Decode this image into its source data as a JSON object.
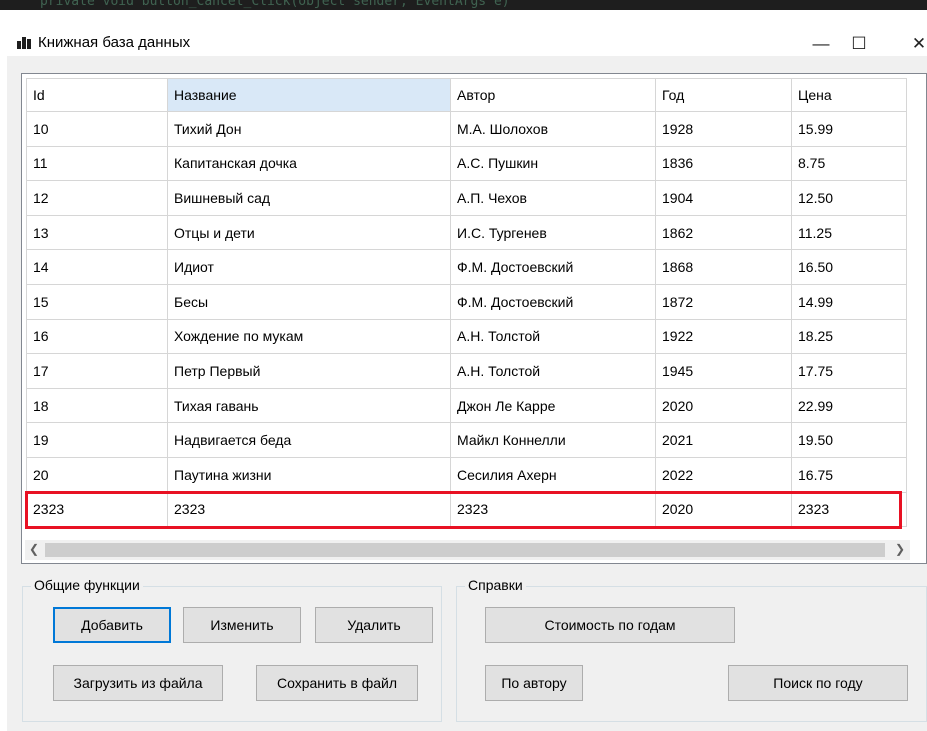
{
  "code_strip_text": "private void button_Cancel_Click(object sender, EventArgs e)",
  "window": {
    "title": "Книжная база данных",
    "minimize_glyph": "—",
    "maximize_glyph": "☐",
    "close_glyph": "✕"
  },
  "grid": {
    "columns": [
      "Id",
      "Название",
      "Автор",
      "Год",
      "Цена"
    ],
    "selected_column": "Название",
    "rows": [
      [
        "10",
        "Тихий Дон",
        "М.А. Шолохов",
        "1928",
        "15.99"
      ],
      [
        "11",
        "Капитанская дочка",
        "А.С. Пушкин",
        "1836",
        "8.75"
      ],
      [
        "12",
        "Вишневый сад",
        "А.П. Чехов",
        "1904",
        "12.50"
      ],
      [
        "13",
        "Отцы и дети",
        "И.С. Тургенев",
        "1862",
        "11.25"
      ],
      [
        "14",
        "Идиот",
        "Ф.М. Достоевский",
        "1868",
        "16.50"
      ],
      [
        "15",
        "Бесы",
        "Ф.М. Достоевский",
        "1872",
        "14.99"
      ],
      [
        "16",
        "Хождение по мукам",
        "А.Н. Толстой",
        "1922",
        "18.25"
      ],
      [
        "17",
        "Петр Первый",
        "А.Н. Толстой",
        "1945",
        "17.75"
      ],
      [
        "18",
        "Тихая гавань",
        "Джон Ле Карре",
        "2020",
        "22.99"
      ],
      [
        "19",
        "Надвигается беда",
        "Майкл Коннелли",
        "2021",
        "19.50"
      ],
      [
        "20",
        "Паутина жизни",
        "Сесилия Ахерн",
        "2022",
        "16.75"
      ],
      [
        "2323",
        "2323",
        "2323",
        "2020",
        "2323"
      ]
    ],
    "highlighted_row_index": 11,
    "highlight_color": "#e81123"
  },
  "general_group": {
    "label": "Общие функции",
    "add_label": "Добавить",
    "edit_label": "Изменить",
    "delete_label": "Удалить",
    "load_label": "Загрузить из файла",
    "save_label": "Сохранить в файл"
  },
  "reports_group": {
    "label": "Справки",
    "cost_by_year_label": "Стоимость по годам",
    "by_author_label": "По автору",
    "search_by_year_label": "Поиск по году"
  },
  "icons": {
    "scroll_up": "▲",
    "scroll_down": "▼",
    "scroll_left": "❮",
    "scroll_right": "❯"
  },
  "colors": {
    "accent": "#0078d7",
    "selected_header": "#d9e8f7"
  }
}
